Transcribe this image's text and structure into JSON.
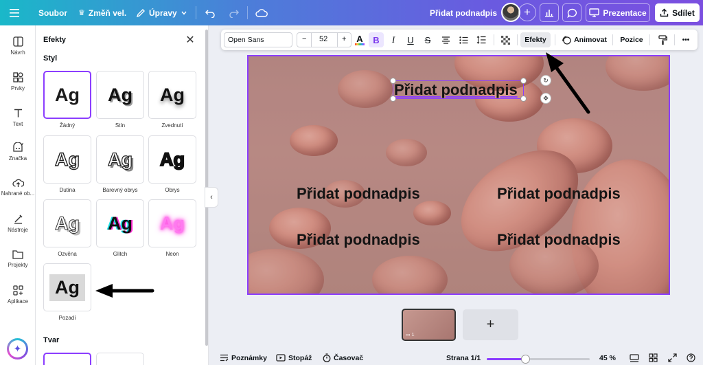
{
  "topbar": {
    "menu_icon": "hamburger-icon",
    "file": "Soubor",
    "resize": "Změň vel.",
    "edit": "Úpravy",
    "doc_title": "Přidat podnadpis",
    "present": "Prezentace",
    "share": "Sdílet"
  },
  "rail": {
    "items": [
      {
        "label": "Návrh",
        "icon": "layout-icon"
      },
      {
        "label": "Prvky",
        "icon": "shapes-icon"
      },
      {
        "label": "Text",
        "icon": "text-icon"
      },
      {
        "label": "Značka",
        "icon": "brand-icon"
      },
      {
        "label": "Nahrané ob...",
        "icon": "upload-icon"
      },
      {
        "label": "Nástroje",
        "icon": "tools-icon"
      },
      {
        "label": "Projekty",
        "icon": "folder-icon"
      },
      {
        "label": "Aplikace",
        "icon": "apps-icon"
      }
    ]
  },
  "panel": {
    "title": "Efekty",
    "style_heading": "Styl",
    "shape_heading": "Tvar",
    "sample": "Ag",
    "styles": [
      {
        "label": "Žádný",
        "selected": true
      },
      {
        "label": "Stín"
      },
      {
        "label": "Zvednutí"
      },
      {
        "label": "Dutina"
      },
      {
        "label": "Barevný obrys"
      },
      {
        "label": "Obrys"
      },
      {
        "label": "Ozvěna"
      },
      {
        "label": "Glitch"
      },
      {
        "label": "Neon"
      },
      {
        "label": "Pozadí"
      }
    ]
  },
  "format": {
    "font": "Open Sans",
    "minus": "−",
    "size": "52",
    "plus": "+",
    "effects": "Efekty",
    "animate": "Animovat",
    "position": "Pozice",
    "more": "•••"
  },
  "canvas": {
    "subtitle_top": "Přidat podnadpis",
    "subtitle_1": "Přidat podnadpis",
    "subtitle_2": "Přidat podnadpis",
    "subtitle_3": "Přidat podnadpis",
    "subtitle_4": "Přidat podnadpis"
  },
  "pages": {
    "thumb_number": "1",
    "add": "+"
  },
  "bottombar": {
    "notes": "Poznámky",
    "timer_stop": "Stopáž",
    "timer": "Časovač",
    "page": "Strana 1/1",
    "zoom": "45 %",
    "zoom_fraction": 0.45
  },
  "colors": {
    "accent": "#8b3dff"
  }
}
